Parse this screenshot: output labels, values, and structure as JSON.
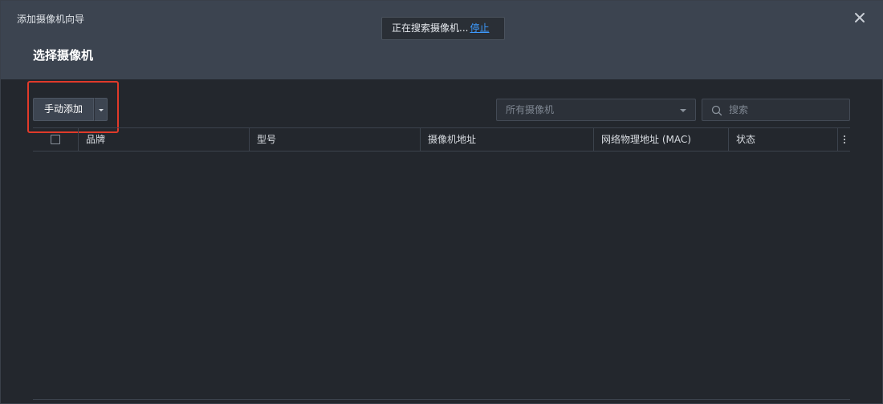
{
  "dialog": {
    "wizard_title": "添加摄像机向导",
    "step_title": "选择摄像机",
    "close_icon": "close-icon"
  },
  "toast": {
    "text": "正在搜索摄像机...",
    "stop_label": "停止"
  },
  "toolbar": {
    "add_label": "手动添加",
    "filter": {
      "selected": "所有摄像机"
    },
    "search": {
      "placeholder": "搜索",
      "value": ""
    }
  },
  "table": {
    "columns": [
      "品牌",
      "型号",
      "摄像机地址",
      "网络物理地址 (MAC)",
      "状态"
    ],
    "rows": []
  },
  "colors": {
    "header_bg": "#3c4450",
    "body_bg": "#23272d",
    "link": "#3d9bff",
    "highlight": "#e03a2a"
  }
}
